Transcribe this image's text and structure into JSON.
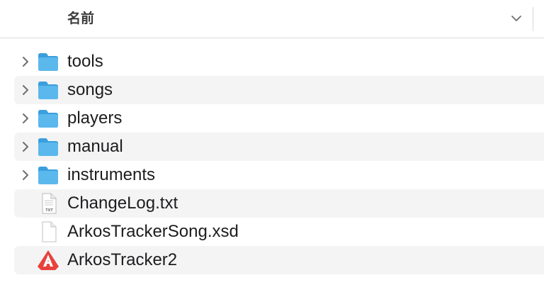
{
  "header": {
    "column_label": "名前",
    "sort_icon": "chevron-down-icon"
  },
  "items": [
    {
      "name": "tools",
      "kind": "folder",
      "icon": "folder-icon",
      "expandable": true
    },
    {
      "name": "songs",
      "kind": "folder",
      "icon": "folder-icon",
      "expandable": true
    },
    {
      "name": "players",
      "kind": "folder",
      "icon": "folder-icon",
      "expandable": true
    },
    {
      "name": "manual",
      "kind": "folder",
      "icon": "folder-icon",
      "expandable": true
    },
    {
      "name": "instruments",
      "kind": "folder",
      "icon": "folder-icon",
      "expandable": true
    },
    {
      "name": "ChangeLog.txt",
      "kind": "file",
      "icon": "txt-file-icon",
      "icon_badge": "TXT",
      "expandable": false
    },
    {
      "name": "ArkosTrackerSong.xsd",
      "kind": "file",
      "icon": "document-icon",
      "expandable": false
    },
    {
      "name": "ArkosTracker2",
      "kind": "app",
      "icon": "arkos-app-icon",
      "expandable": false
    }
  ],
  "colors": {
    "folder": "#5bb8ec",
    "folder_dark": "#3a9fdc",
    "row_alt": "#f4f4f5",
    "app_red": "#e8413d"
  }
}
